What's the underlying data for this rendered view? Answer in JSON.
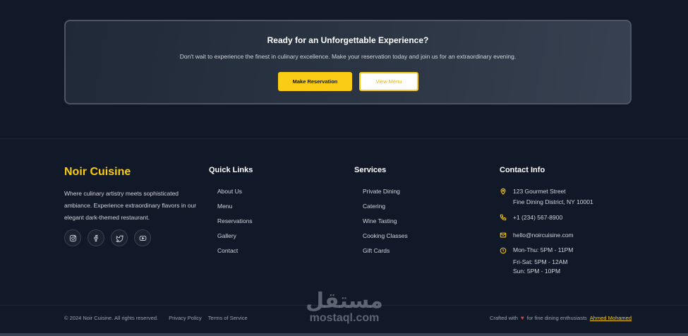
{
  "cta": {
    "title": "Ready for an Unforgettable Experience?",
    "subtitle": "Don't wait to experience the finest in culinary excellence. Make your reservation today and join us for an extraordinary evening.",
    "primary_button": "Make Reservation",
    "secondary_button": "View Menu"
  },
  "brand": {
    "name": "Noir Cuisine",
    "tagline": "Where culinary artistry meets sophisticated ambiance. Experience extraordinary flavors in our elegant dark-themed restaurant.",
    "socials": [
      "instagram-icon",
      "facebook-icon",
      "twitter-icon",
      "youtube-icon"
    ]
  },
  "quick_links": {
    "title": "Quick Links",
    "items": [
      "About Us",
      "Menu",
      "Reservations",
      "Gallery",
      "Contact"
    ]
  },
  "services": {
    "title": "Services",
    "items": [
      "Private Dining",
      "Catering",
      "Wine Tasting",
      "Cooking Classes",
      "Gift Cards"
    ]
  },
  "contact": {
    "title": "Contact Info",
    "address_line1": "123 Gourmet Street",
    "address_line2": "Fine Dining District, NY 10001",
    "phone": "+1 (234) 567-8900",
    "email": "hello@noircuisine.com",
    "hours_line1": "Mon-Thu: 5PM - 11PM",
    "hours_line2": "Fri-Sat: 5PM - 12AM",
    "hours_line3": "Sun: 5PM - 10PM"
  },
  "footer": {
    "copyright": "© 2024 Noir Cuisine. All rights reserved.",
    "privacy": "Privacy Policy",
    "terms": "Terms of Service",
    "crafted_prefix": "Crafted with",
    "crafted_suffix": "for fine dining enthusiasts",
    "author": "Ahmed Mohamed"
  },
  "watermark": {
    "arabic": "مستقل",
    "latin": "mostaql.com"
  },
  "colors": {
    "background": "#111827",
    "accent": "#facc15",
    "heart": "#ef4444"
  }
}
